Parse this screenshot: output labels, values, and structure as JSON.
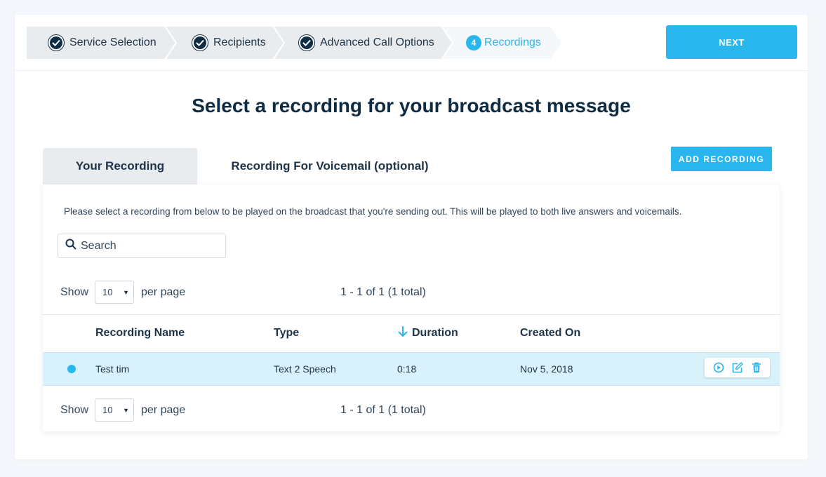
{
  "steps": [
    {
      "label": "Service Selection",
      "state": "complete"
    },
    {
      "label": "Recipients",
      "state": "complete"
    },
    {
      "label": "Advanced Call Options",
      "state": "complete"
    },
    {
      "label": "Recordings",
      "number": "4",
      "state": "active"
    }
  ],
  "next_label": "NEXT",
  "page_title": "Select a recording for your broadcast message",
  "tabs": [
    {
      "label": "Your Recording",
      "selected": true
    },
    {
      "label": "Recording For Voicemail (optional)",
      "selected": false
    }
  ],
  "add_recording_label": "ADD RECORDING",
  "description": "Please select a recording from below to be played on the broadcast that you're sending out. This will be played to both live answers and voicemails.",
  "search": {
    "placeholder": "Search",
    "value": ""
  },
  "pagination": {
    "show_label": "Show",
    "per_page_value": "10",
    "per_page_label": "per page",
    "summary": "1 - 1 of 1 (1 total)"
  },
  "table": {
    "columns": [
      "Recording Name",
      "Type",
      "Duration",
      "Created On"
    ],
    "sort_column": "Duration",
    "rows": [
      {
        "name": "Test tim",
        "type": "Text 2 Speech",
        "duration": "0:18",
        "created_on": "Nov 5, 2018",
        "selected": true
      }
    ]
  },
  "icons": {
    "step_complete": "check-icon",
    "search": "search-icon",
    "sort": "arrow-down-icon",
    "row_actions": [
      "play-icon",
      "edit-icon",
      "trash-icon"
    ]
  },
  "colors": {
    "accent": "#29b6ec",
    "navy": "#0f2c45",
    "row_selected": "#d9f1fb",
    "step_bg": "#e9ecef",
    "step_active_bg": "#f4f8fb"
  }
}
